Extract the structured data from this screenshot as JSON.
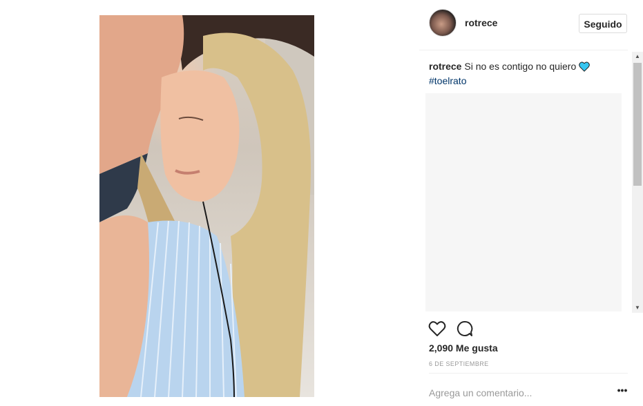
{
  "post": {
    "username": "rotrece",
    "follow_label": "Seguido",
    "caption_user": "rotrece",
    "caption_text": "Si no es contigo no quiero",
    "hashtag": "#toelrato",
    "likes": "2,090 Me gusta",
    "date": "6 DE SEPTIEMBRE",
    "comment_placeholder": "Agrega un comentario...",
    "more_options": "•••"
  },
  "colors": {
    "heart_emoji": "#36c5f0",
    "hashtag": "#003569",
    "muted": "#999999"
  },
  "icons": {
    "like": "heart-outline-icon",
    "comment": "speech-bubble-icon",
    "caption_emoji": "blue-heart-emoji-icon"
  }
}
